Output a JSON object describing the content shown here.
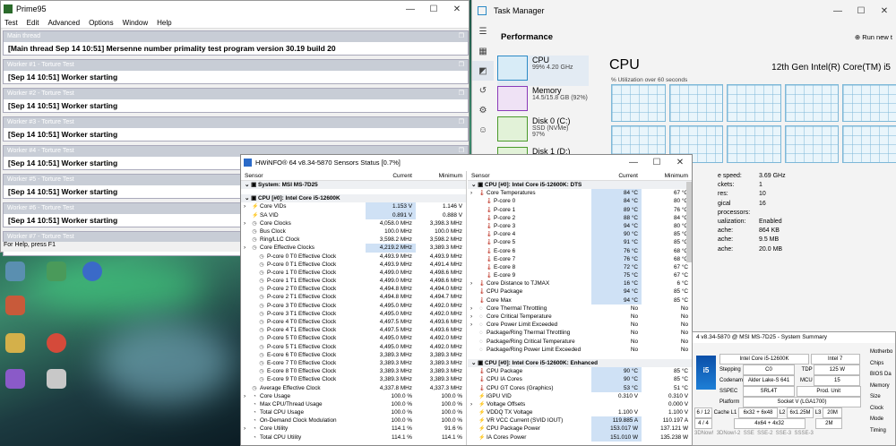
{
  "prime95": {
    "title": "Prime95",
    "menu": [
      "Test",
      "Edit",
      "Advanced",
      "Options",
      "Window",
      "Help"
    ],
    "windows": [
      {
        "title": "Main thread",
        "line": "[Main thread Sep 14 10:51] Mersenne number primality test program version 30.19 build 20"
      },
      {
        "title": "Worker #1 - Torture Test",
        "line": "[Sep 14 10:51] Worker starting"
      },
      {
        "title": "Worker #2 - Torture Test",
        "line": "[Sep 14 10:51] Worker starting"
      },
      {
        "title": "Worker #3 - Torture Test",
        "line": "[Sep 14 10:51] Worker starting"
      },
      {
        "title": "Worker #4 - Torture Test",
        "line": "[Sep 14 10:51] Worker starting"
      },
      {
        "title": "Worker #5 - Torture Test",
        "line": "[Sep 14 10:51] Worker starting"
      },
      {
        "title": "Worker #6 - Torture Test",
        "line": "[Sep 14 10:51] Worker starting"
      },
      {
        "title": "Worker #7 - Torture Test",
        "line": ""
      }
    ],
    "status": "For Help, press F1"
  },
  "taskmanager": {
    "title": "Task Manager",
    "section": "Performance",
    "run_new": "Run new t",
    "items": [
      {
        "name": "CPU",
        "sub1": "99%  4.20 GHz",
        "sub2": ""
      },
      {
        "name": "Memory",
        "sub1": "14.5/15.8 GB (92%)",
        "sub2": ""
      },
      {
        "name": "Disk 0 (C:)",
        "sub1": "SSD (NVMe)",
        "sub2": "97%"
      },
      {
        "name": "Disk 1 (D:)",
        "sub1": "",
        "sub2": ""
      }
    ],
    "cpu_heading": "CPU",
    "cpu_model": "12th Gen Intel(R) Core(TM) i5",
    "util_label": "% Utilization over 60 seconds",
    "stats": [
      {
        "k": "e speed:",
        "v": "3.69 GHz"
      },
      {
        "k": "ckets:",
        "v": "1"
      },
      {
        "k": "res:",
        "v": "10"
      },
      {
        "k": "gical processors:",
        "v": "16"
      },
      {
        "k": "ualization:",
        "v": "Enabled"
      },
      {
        "k": "ache:",
        "v": "864 KB"
      },
      {
        "k": "ache:",
        "v": "9.5 MB"
      },
      {
        "k": "ache:",
        "v": "20.0 MB"
      }
    ]
  },
  "hwinfo": {
    "title": "HWiNFO® 64 v8.34-5870 Sensors Status [0.7%]",
    "col_sensor": "Sensor",
    "col_current": "Current",
    "col_minimum": "Minimum",
    "left_rows": [
      {
        "t": "sec",
        "n": "System: MSI MS-7D25",
        "c": "",
        "m": ""
      },
      {
        "t": "gap",
        "n": "",
        "c": "",
        "m": ""
      },
      {
        "t": "sec",
        "n": "CPU [#0]: Intel Core i5-12600K",
        "c": "",
        "m": ""
      },
      {
        "t": "r1",
        "i": "⚡",
        "n": "Core VIDs",
        "c": "1.153 V",
        "m": "1.146 V",
        "hl": true
      },
      {
        "t": "r0",
        "i": "⚡",
        "n": "SA VID",
        "c": "0.891 V",
        "m": "0.888 V",
        "hl": true
      },
      {
        "t": "r1",
        "i": "◷",
        "n": "Core Clocks",
        "c": "4,058.0 MHz",
        "m": "3,398.3 MHz"
      },
      {
        "t": "r0",
        "i": "◷",
        "n": "Bus Clock",
        "c": "100.0 MHz",
        "m": "100.0 MHz"
      },
      {
        "t": "r0",
        "i": "◷",
        "n": "Ring/LLC Clock",
        "c": "3,598.2 MHz",
        "m": "3,598.2 MHz"
      },
      {
        "t": "r1",
        "i": "◷",
        "n": "Core Effective Clocks",
        "c": "4,219.2 MHz",
        "m": "3,389.3 MHz",
        "hl": true
      },
      {
        "t": "r2",
        "i": "◷",
        "n": "P-core 0 T0 Effective Clock",
        "c": "4,493.9 MHz",
        "m": "4,493.9 MHz"
      },
      {
        "t": "r2",
        "i": "◷",
        "n": "P-core 0 T1 Effective Clock",
        "c": "4,493.9 MHz",
        "m": "4,491.4 MHz"
      },
      {
        "t": "r2",
        "i": "◷",
        "n": "P-core 1 T0 Effective Clock",
        "c": "4,499.0 MHz",
        "m": "4,498.6 MHz"
      },
      {
        "t": "r2",
        "i": "◷",
        "n": "P-core 1 T1 Effective Clock",
        "c": "4,499.0 MHz",
        "m": "4,498.6 MHz"
      },
      {
        "t": "r2",
        "i": "◷",
        "n": "P-core 2 T0 Effective Clock",
        "c": "4,494.8 MHz",
        "m": "4,494.0 MHz"
      },
      {
        "t": "r2",
        "i": "◷",
        "n": "P-core 2 T1 Effective Clock",
        "c": "4,494.8 MHz",
        "m": "4,494.7 MHz"
      },
      {
        "t": "r2",
        "i": "◷",
        "n": "P-core 3 T0 Effective Clock",
        "c": "4,495.0 MHz",
        "m": "4,492.0 MHz"
      },
      {
        "t": "r2",
        "i": "◷",
        "n": "P-core 3 T1 Effective Clock",
        "c": "4,495.0 MHz",
        "m": "4,492.0 MHz"
      },
      {
        "t": "r2",
        "i": "◷",
        "n": "P-core 4 T0 Effective Clock",
        "c": "4,497.5 MHz",
        "m": "4,493.6 MHz"
      },
      {
        "t": "r2",
        "i": "◷",
        "n": "P-core 4 T1 Effective Clock",
        "c": "4,497.5 MHz",
        "m": "4,493.6 MHz"
      },
      {
        "t": "r2",
        "i": "◷",
        "n": "P-core 5 T0 Effective Clock",
        "c": "4,495.0 MHz",
        "m": "4,492.0 MHz"
      },
      {
        "t": "r2",
        "i": "◷",
        "n": "P-core 5 T1 Effective Clock",
        "c": "4,495.0 MHz",
        "m": "4,492.0 MHz"
      },
      {
        "t": "r2",
        "i": "◷",
        "n": "E-core 6 T0 Effective Clock",
        "c": "3,389.3 MHz",
        "m": "3,389.3 MHz"
      },
      {
        "t": "r2",
        "i": "◷",
        "n": "E-core 7 T0 Effective Clock",
        "c": "3,389.3 MHz",
        "m": "3,389.3 MHz"
      },
      {
        "t": "r2",
        "i": "◷",
        "n": "E-core 8 T0 Effective Clock",
        "c": "3,389.3 MHz",
        "m": "3,389.3 MHz"
      },
      {
        "t": "r2",
        "i": "◷",
        "n": "E-core 9 T0 Effective Clock",
        "c": "3,389.3 MHz",
        "m": "3,389.3 MHz"
      },
      {
        "t": "r0",
        "i": "◷",
        "n": "Average Effective Clock",
        "c": "4,337.8 MHz",
        "m": "4,337.3 MHz"
      },
      {
        "t": "r1",
        "i": "◔",
        "n": "Core Usage",
        "c": "100.0 %",
        "m": "100.0 %"
      },
      {
        "t": "r0",
        "i": "◔",
        "n": "Max CPU/Thread Usage",
        "c": "100.0 %",
        "m": "100.0 %"
      },
      {
        "t": "r0",
        "i": "◔",
        "n": "Total CPU Usage",
        "c": "100.0 %",
        "m": "100.0 %"
      },
      {
        "t": "r0",
        "i": "◔",
        "n": "On-Demand Clock Modulation",
        "c": "100.0 %",
        "m": "100.0 %"
      },
      {
        "t": "r1",
        "i": "◔",
        "n": "Core Utility",
        "c": "114.1 %",
        "m": "91.6 %"
      },
      {
        "t": "r0",
        "i": "◔",
        "n": "Total CPU Utility",
        "c": "114.1 %",
        "m": "114.1 %"
      }
    ],
    "right_rows": [
      {
        "t": "sec",
        "n": "CPU [#0]: Intel Core i5-12600K: DTS",
        "c": "",
        "m": ""
      },
      {
        "t": "r1",
        "i": "🌡",
        "n": "Core Temperatures",
        "c": "84 °C",
        "m": "67 °C",
        "hl": true
      },
      {
        "t": "r2",
        "i": "🌡",
        "n": "P-core 0",
        "c": "84 °C",
        "m": "80 °C",
        "hl": true
      },
      {
        "t": "r2",
        "i": "🌡",
        "n": "P-core 1",
        "c": "89 °C",
        "m": "76 °C",
        "hl": true
      },
      {
        "t": "r2",
        "i": "🌡",
        "n": "P-core 2",
        "c": "88 °C",
        "m": "84 °C",
        "hl": true
      },
      {
        "t": "r2",
        "i": "🌡",
        "n": "P-core 3",
        "c": "94 °C",
        "m": "80 °C",
        "hl": true
      },
      {
        "t": "r2",
        "i": "🌡",
        "n": "P-core 4",
        "c": "90 °C",
        "m": "85 °C",
        "hl": true
      },
      {
        "t": "r2",
        "i": "🌡",
        "n": "P-core 5",
        "c": "91 °C",
        "m": "85 °C",
        "hl": true
      },
      {
        "t": "r2",
        "i": "🌡",
        "n": "E-core 6",
        "c": "76 °C",
        "m": "68 °C",
        "hl": true
      },
      {
        "t": "r2",
        "i": "🌡",
        "n": "E-core 7",
        "c": "76 °C",
        "m": "68 °C",
        "hl": true
      },
      {
        "t": "r2",
        "i": "🌡",
        "n": "E-core 8",
        "c": "72 °C",
        "m": "67 °C",
        "hl": true
      },
      {
        "t": "r2",
        "i": "🌡",
        "n": "E-core 9",
        "c": "75 °C",
        "m": "67 °C",
        "hl": true
      },
      {
        "t": "r1",
        "i": "🌡",
        "n": "Core Distance to TJMAX",
        "c": "16 °C",
        "m": "6 °C",
        "hl": true
      },
      {
        "t": "r0",
        "i": "🌡",
        "n": "CPU Package",
        "c": "94 °C",
        "m": "85 °C",
        "hl": true
      },
      {
        "t": "r0",
        "i": "🌡",
        "n": "Core Max",
        "c": "94 °C",
        "m": "85 °C",
        "hl": true
      },
      {
        "t": "r1",
        "i": "◌",
        "n": "Core Thermal Throttling",
        "c": "No",
        "m": "No"
      },
      {
        "t": "r1",
        "i": "◌",
        "n": "Core Critical Temperature",
        "c": "No",
        "m": "No"
      },
      {
        "t": "r1",
        "i": "◌",
        "n": "Core Power Limit Exceeded",
        "c": "No",
        "m": "No"
      },
      {
        "t": "r0",
        "i": "◌",
        "n": "Package/Ring Thermal Throttling",
        "c": "No",
        "m": "No"
      },
      {
        "t": "r0",
        "i": "◌",
        "n": "Package/Ring Critical Temperature",
        "c": "No",
        "m": "No"
      },
      {
        "t": "r0",
        "i": "◌",
        "n": "Package/Ring Power Limit Exceeded",
        "c": "No",
        "m": "No"
      },
      {
        "t": "gap",
        "n": "",
        "c": "",
        "m": ""
      },
      {
        "t": "sec",
        "n": "CPU [#0]: Intel Core i5-12600K: Enhanced",
        "c": "",
        "m": ""
      },
      {
        "t": "r0",
        "i": "🌡",
        "n": "CPU Package",
        "c": "90 °C",
        "m": "85 °C",
        "hl": true
      },
      {
        "t": "r0",
        "i": "🌡",
        "n": "CPU IA Cores",
        "c": "90 °C",
        "m": "85 °C",
        "hl": true
      },
      {
        "t": "r0",
        "i": "🌡",
        "n": "CPU GT Cores (Graphics)",
        "c": "53 °C",
        "m": "51 °C",
        "hl": true
      },
      {
        "t": "r0",
        "i": "⚡",
        "n": "iGPU VID",
        "c": "0.310 V",
        "m": "0.310 V"
      },
      {
        "t": "r1",
        "i": "⚡",
        "n": "Voltage Offsets",
        "c": "",
        "m": "0.000 V"
      },
      {
        "t": "r0",
        "i": "⚡",
        "n": "VDDQ TX Voltage",
        "c": "1.100 V",
        "m": "1.100 V"
      },
      {
        "t": "r0",
        "i": "⚡",
        "n": "VR VCC Current (SVID IOUT)",
        "c": "119.885 A",
        "m": "110.197 A",
        "hl": true
      },
      {
        "t": "r0",
        "i": "⚡",
        "n": "CPU Package Power",
        "c": "153.017 W",
        "m": "137.121 W",
        "hl": true
      },
      {
        "t": "r0",
        "i": "⚡",
        "n": "IA Cores Power",
        "c": "151.010 W",
        "m": "135.238 W",
        "hl": true
      }
    ]
  },
  "summary": {
    "title": "4 v8.34-5870 @ MSI MS-7D25 - System Summary",
    "logo": "i5",
    "cpu_name": "Intel Core i5-12600K",
    "brand": "Intel 7",
    "stepping_k": "Stepping",
    "stepping_v": "C0",
    "tdp_k": "TDP",
    "tdp_v": "125 W",
    "codename_k": "Codename",
    "codename_v": "Alder Lake-S 641",
    "mcu_k": "MCU",
    "mcu_v": "15",
    "sspec_k": "SSPEC",
    "sspec_v": "SRL4T",
    "produnit": "Prod. Unit",
    "platform_k": "Platform",
    "platform_v": "Socket V (LGA1700)",
    "cores": "6 / 12",
    "cache_l1_k": "Cache L1",
    "cache_l1_v": "6x32 + 6x48",
    "l2_k": "L2",
    "l2_v": "6x1.25M",
    "l3_k": "L3",
    "l3_v": "20M",
    "ecores": "4 / 4",
    "cache_e": "4x64 + 4x32",
    "l2e_v": "2M",
    "side": [
      "Motherbo",
      "Chips",
      "BIOS Da",
      "Memory",
      "Size",
      "Clock",
      "Mode",
      "Timing"
    ],
    "feat": [
      "3DNow!",
      "3DNow!-2",
      "SSE",
      "SSE-2",
      "SSE-3",
      "SSSE-3"
    ]
  }
}
